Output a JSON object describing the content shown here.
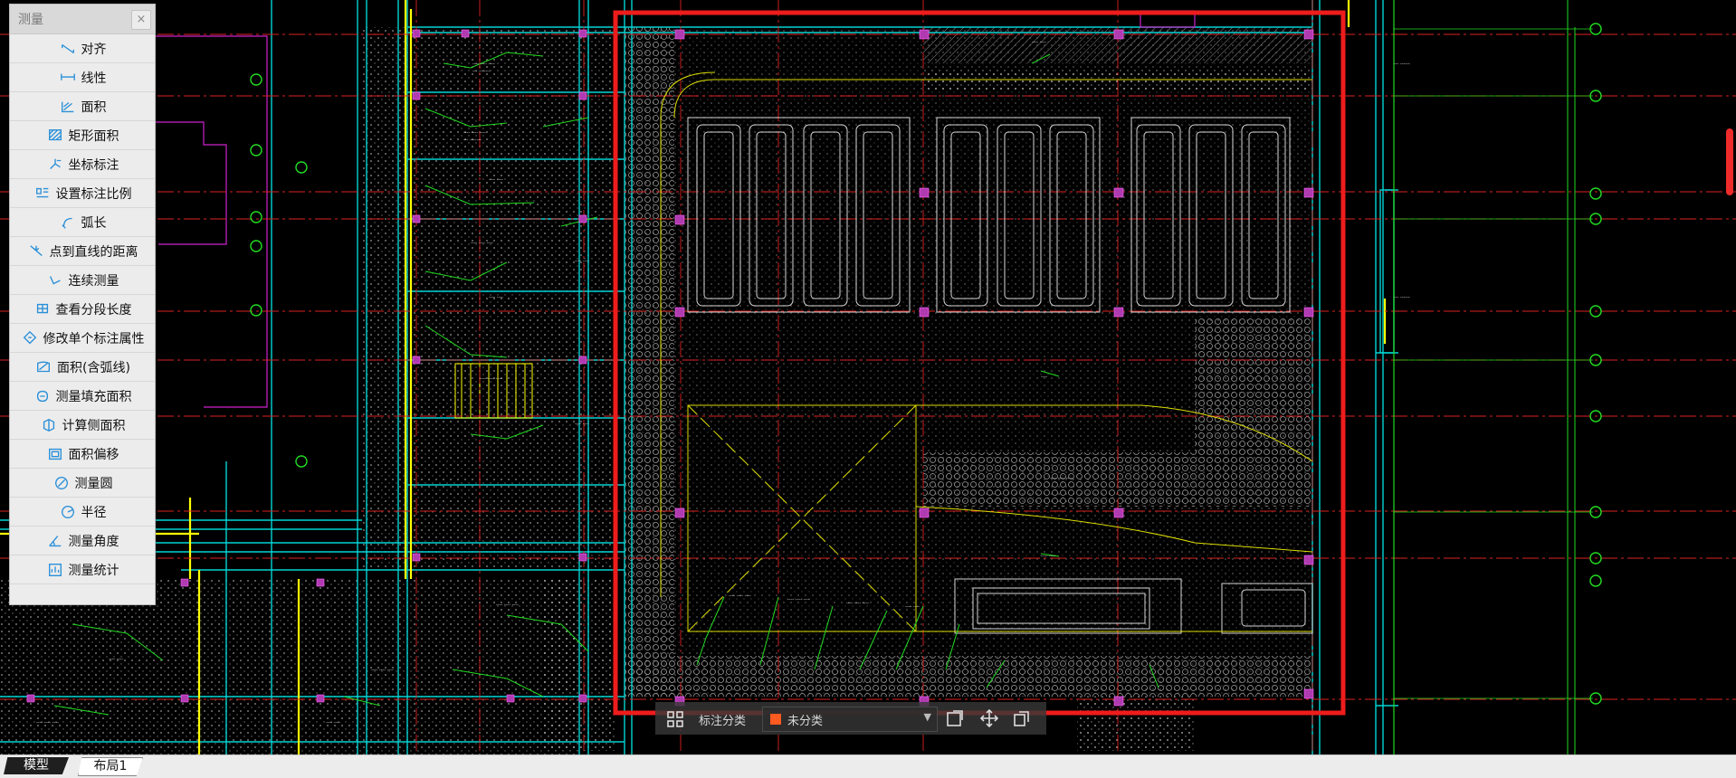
{
  "measure_panel": {
    "title": "测量",
    "close_label": "×",
    "items": [
      {
        "label": "对齐",
        "icon": "align-measure-icon"
      },
      {
        "label": "线性",
        "icon": "linear-measure-icon"
      },
      {
        "label": "面积",
        "icon": "area-icon"
      },
      {
        "label": "矩形面积",
        "icon": "rect-area-icon"
      },
      {
        "label": "坐标标注",
        "icon": "coordinate-icon"
      },
      {
        "label": "设置标注比例",
        "icon": "scale-icon"
      },
      {
        "label": "弧长",
        "icon": "arc-length-icon"
      },
      {
        "label": "点到直线的距离",
        "icon": "point-line-distance-icon"
      },
      {
        "label": "连续测量",
        "icon": "continuous-measure-icon"
      },
      {
        "label": "查看分段长度",
        "icon": "segment-length-icon"
      },
      {
        "label": "修改单个标注属性",
        "icon": "edit-annotation-icon"
      },
      {
        "label": "面积(含弧线)",
        "icon": "arc-area-icon"
      },
      {
        "label": "测量填充面积",
        "icon": "fill-area-icon"
      },
      {
        "label": "计算侧面积",
        "icon": "side-area-icon"
      },
      {
        "label": "面积偏移",
        "icon": "area-offset-icon"
      },
      {
        "label": "测量圆",
        "icon": "circle-measure-icon"
      },
      {
        "label": "半径",
        "icon": "radius-icon"
      },
      {
        "label": "测量角度",
        "icon": "angle-icon"
      },
      {
        "label": "测量统计",
        "icon": "statistics-icon"
      }
    ]
  },
  "annotation_bar": {
    "label": "标注分类",
    "select_value": "未分类",
    "swatch_color": "#ff5a1f"
  },
  "tabs": {
    "model": "模型",
    "layout": "布局1"
  },
  "colors": {
    "background": "#000000",
    "highlight_frame": "#ee1c1c",
    "cad_cyan": "#00d4d4",
    "cad_yellow": "#ffff00",
    "cad_green": "#22dd22",
    "cad_magenta": "#ff00ff"
  }
}
